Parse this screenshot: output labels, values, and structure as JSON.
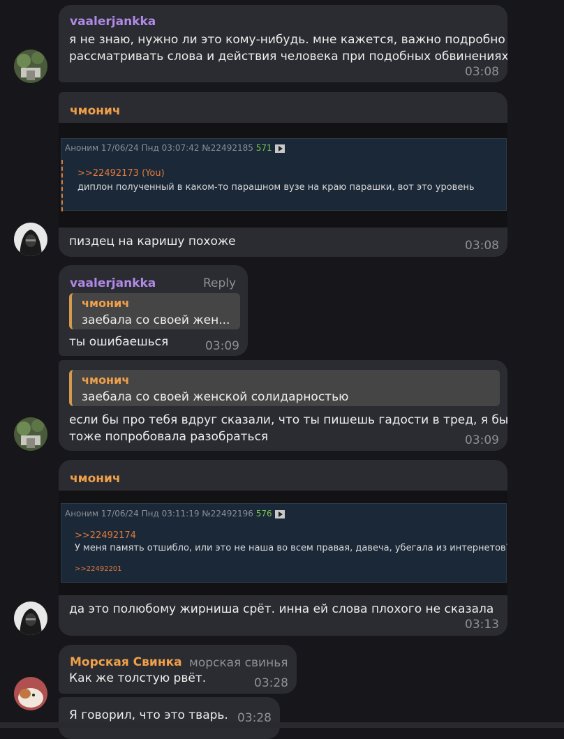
{
  "messages": [
    {
      "author": "vaalerjankka",
      "lines": [
        "я не знаю, нужно ли это кому-нибудь. мне кажется, важно подробно",
        "рассматривать слова и действия человека при подобных обвинениях"
      ],
      "time": "03:08"
    },
    {
      "author": "чмонич",
      "post": {
        "header": "Аноним 17/06/24 Пнд 03:07:42 №22492185",
        "count": "571",
        "ref": ">>22492173 (You)",
        "text": "диплон полученный в каком-то парашном вузе на краю парашки, вот это уровень"
      },
      "text": "пиздец на каришу похоже",
      "time": "03:08"
    },
    {
      "author": "vaalerjankka",
      "reply_label": "Reply",
      "quote": {
        "author": "чмонич",
        "text": "заебала со своей жен..."
      },
      "text": "ты ошибаешься",
      "time": "03:09"
    },
    {
      "quote": {
        "author": "чмонич",
        "text": "заебала со своей женской солидарностью"
      },
      "lines": [
        "если бы про тебя вдруг сказали, что ты пишешь гадости в тред, я бы",
        "тоже попробовала разобраться"
      ],
      "time": "03:09"
    },
    {
      "author": "чмонич",
      "post": {
        "header": "Аноним 17/06/24 Пнд 03:11:19 №22492196",
        "count": "576",
        "ref": ">>22492174",
        "text": "У меня память отшибло, или это не наша во всем правая, давеча, убегала из интернетов?",
        "ref2": ">>22492201"
      },
      "text": "да это полюбому жирниша срёт. инна ей слова плохого не сказала",
      "time": "03:13"
    },
    {
      "author": "Морская Свинка",
      "subtitle": "морская свинья",
      "text": "Как же толстую рвёт.",
      "time": "03:28"
    },
    {
      "text": "Я говорил, что это тварь.",
      "time": "03:28"
    }
  ]
}
